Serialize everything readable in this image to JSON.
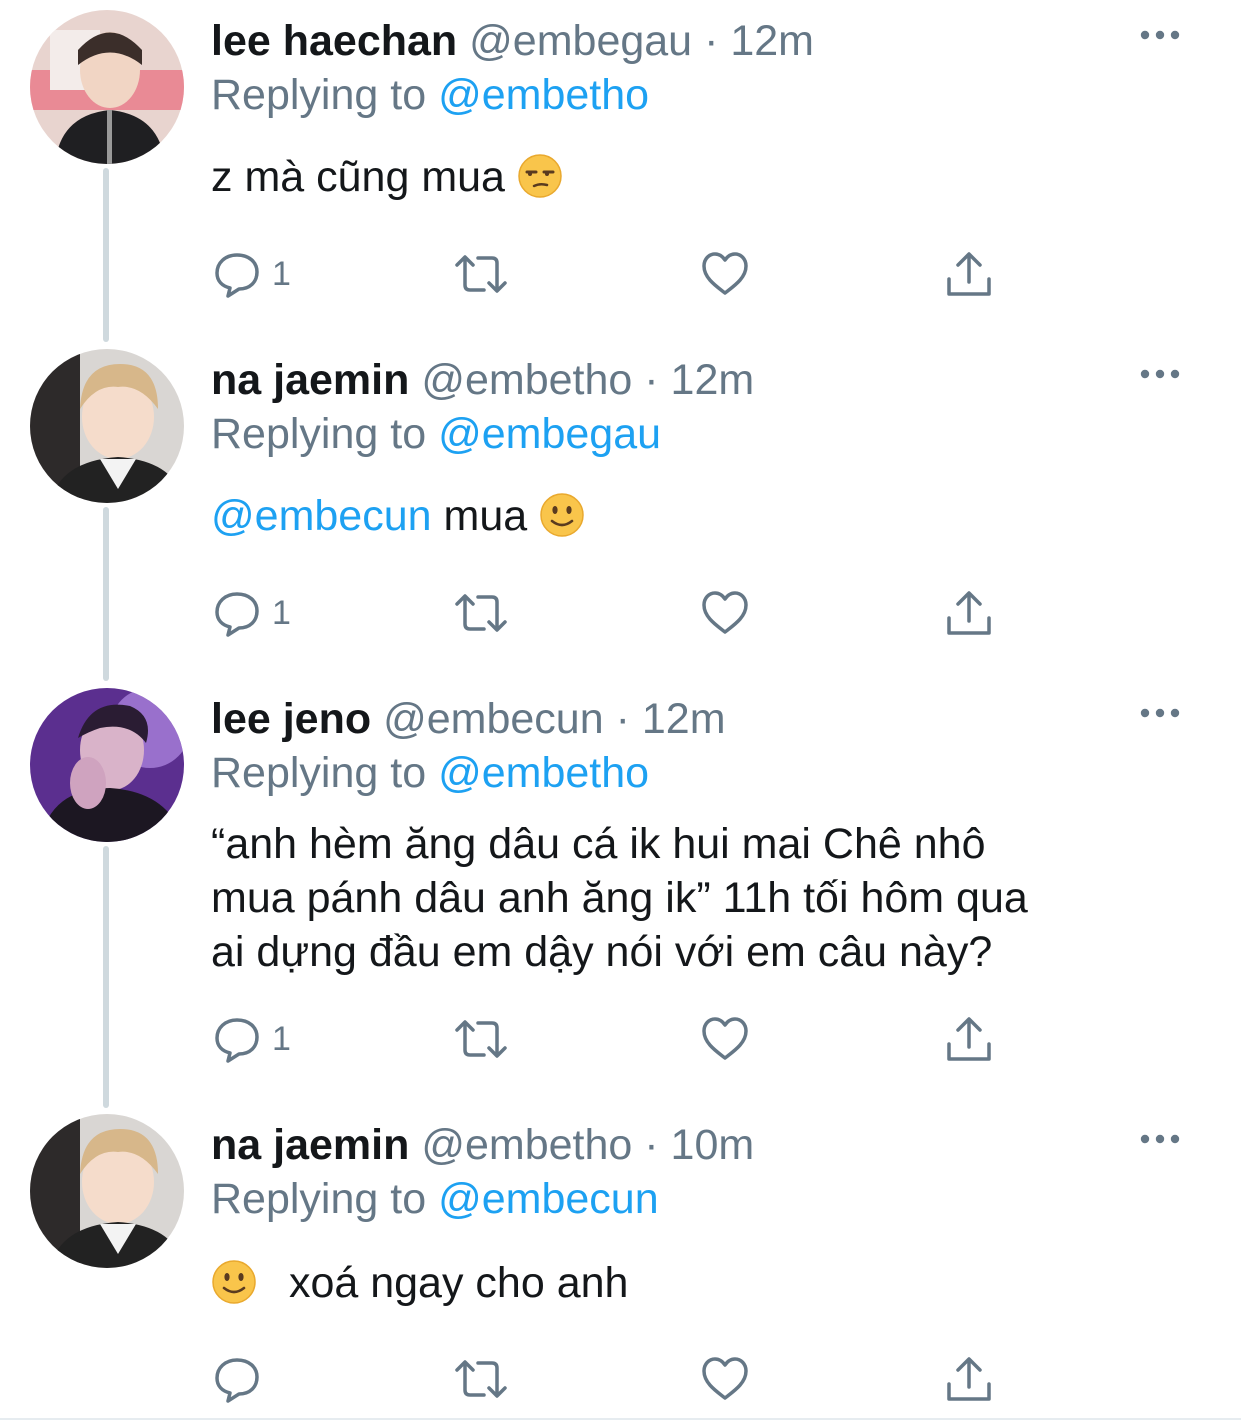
{
  "thread": [
    {
      "name": "lee haechan",
      "handle": "@embegau",
      "sep": "·",
      "time": "12m",
      "replying_label": "Replying to",
      "replying_handle": "@embetho",
      "body_mention": "",
      "body_lines": [
        "z mà cũng mua"
      ],
      "emoji": "unamused-face",
      "reply_count": "1"
    },
    {
      "name": "na jaemin",
      "handle": "@embetho",
      "sep": "·",
      "time": "12m",
      "replying_label": "Replying to",
      "replying_handle": "@embegau",
      "body_mention": "@embecun",
      "body_lines": [
        "mua"
      ],
      "emoji": "slightly-smiling-face",
      "reply_count": "1"
    },
    {
      "name": "lee jeno",
      "handle": "@embecun",
      "sep": "·",
      "time": "12m",
      "replying_label": "Replying to",
      "replying_handle": "@embetho",
      "body_mention": "",
      "body_lines": [
        "“anh hèm ăng dâu cá ik hui mai Chê nhô",
        "mua pánh dâu anh ăng ik” 11h tối hôm qua",
        "ai dựng đầu em dậy nói với em câu này?"
      ],
      "emoji": "",
      "reply_count": "1"
    },
    {
      "name": "na jaemin",
      "handle": "@embetho",
      "sep": "·",
      "time": "10m",
      "replying_label": "Replying to",
      "replying_handle": "@embecun",
      "body_mention": "",
      "body_lines": [
        "xoá ngay cho anh"
      ],
      "emoji": "slightly-smiling-face",
      "reply_count": ""
    }
  ],
  "icons": {
    "reply": "reply-icon",
    "retweet": "retweet-icon",
    "like": "like-icon",
    "share": "share-icon",
    "more": "more-icon"
  },
  "colors": {
    "mention": "#1da1f2",
    "meta": "#657786",
    "text": "#14171a",
    "thread_line": "#cfd9de"
  }
}
